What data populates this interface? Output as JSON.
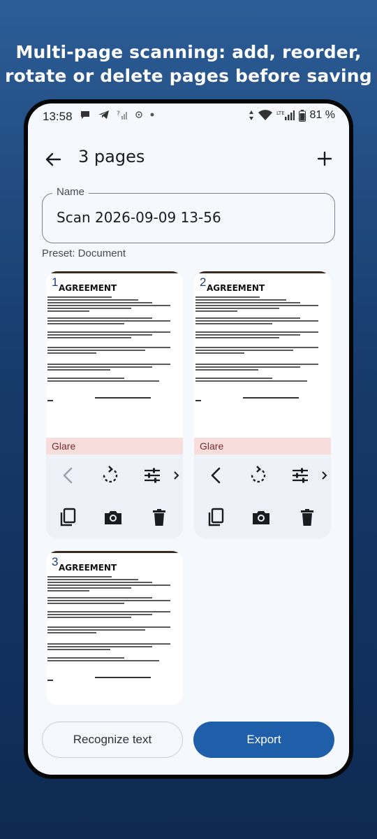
{
  "headline": {
    "line1": "Multi-page scanning: add, reorder,",
    "line2": "rotate or delete pages before saving"
  },
  "status_bar": {
    "time": "13:58",
    "battery_percent": "81 %",
    "icons_left": [
      "chat-bubble-icon",
      "telegram-icon",
      "no-signal-icon",
      "app-notification-icon",
      "dot-icon"
    ],
    "icons_right": [
      "data-arrows-icon",
      "wifi-icon",
      "lte-signal-icon",
      "battery-icon"
    ],
    "lte_label": "LTE"
  },
  "app_bar": {
    "title": "3 pages",
    "back_icon": "arrow-back-icon",
    "add_icon": "plus-icon"
  },
  "name_field": {
    "label": "Name",
    "value": "Scan 2026-09-09 13-56"
  },
  "preset": "Preset: Document",
  "pages": [
    {
      "number": "1",
      "warning": "Glare",
      "has_tools": true,
      "move_left_enabled": false
    },
    {
      "number": "2",
      "warning": "Glare",
      "has_tools": true,
      "move_left_enabled": true
    },
    {
      "number": "3",
      "warning": "",
      "has_tools": false
    }
  ],
  "page_tools": {
    "row1": [
      "move-left-icon",
      "rotate-icon",
      "adjust-icon",
      "more-chevron-icon"
    ],
    "row2": [
      "duplicate-icon",
      "camera-icon",
      "delete-icon"
    ]
  },
  "thumb_text": {
    "heading": "AGREEMENT"
  },
  "buttons": {
    "recognize": "Recognize text",
    "export": "Export"
  },
  "colors": {
    "accent": "#1f5ea8",
    "glare_bg": "#f7dedd",
    "background_top": "#2c5d96",
    "background_bottom": "#0e2a52"
  }
}
